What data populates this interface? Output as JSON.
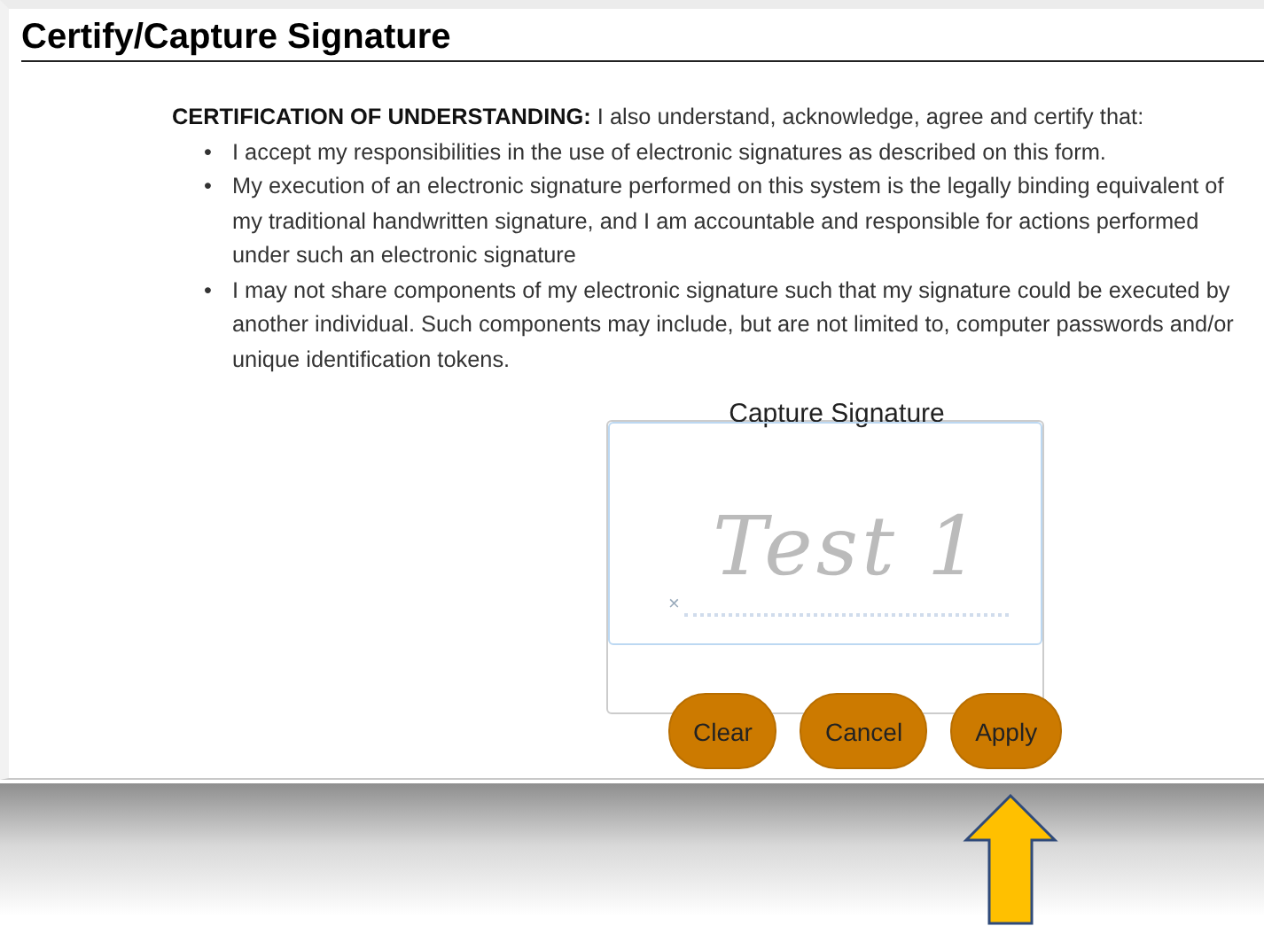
{
  "title": "Certify/Capture Signature",
  "certification": {
    "heading": "CERTIFICATION OF UNDERSTANDING:",
    "intro": "I also understand, acknowledge, agree and certify that:",
    "items": [
      "I accept my responsibilities in the use of electronic signatures as described on this form.",
      "My execution of an electronic signature performed on this system is the legally binding equivalent of my traditional handwritten signature, and I am accountable and responsible for actions performed under such an electronic signature",
      "I may not share components of my electronic signature such that my signature could be executed by another individual. Such components may include, but are not limited to, computer passwords and/or unique identification tokens."
    ]
  },
  "bullet": "•",
  "signature_pad": {
    "title": "Capture Signature",
    "value": "Test 1",
    "marker": "×"
  },
  "buttons": [
    "Clear",
    "Cancel",
    "Apply"
  ]
}
